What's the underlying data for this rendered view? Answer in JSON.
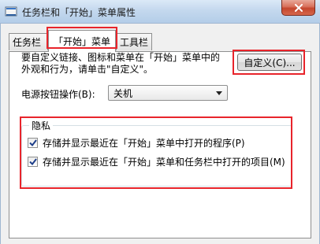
{
  "window": {
    "title": "任务栏和「开始」菜单属性",
    "close_icon": "close-icon"
  },
  "tabs": [
    {
      "label": "任务栏",
      "active": false
    },
    {
      "label": "「开始」菜单",
      "active": true
    },
    {
      "label": "工具栏",
      "active": false
    }
  ],
  "start_menu": {
    "description_line1": "要自定义链接、图标和菜单在「开始」菜单中的",
    "description_line2": "外观和行为，请单击\"自定义\"。",
    "customize_button": "自定义(C)...",
    "power_button_label": "电源按钮操作(B):",
    "power_button_value": "关机"
  },
  "privacy": {
    "legend": "隐私",
    "options": [
      {
        "label": "存储并显示最近在「开始」菜单中打开的程序(P)",
        "checked": true
      },
      {
        "label": "存储并显示最近在「开始」菜单和任务栏中打开的项目(M)",
        "checked": true
      }
    ]
  },
  "colors": {
    "highlight": "#e8242b",
    "close_button": "#c4462d"
  }
}
